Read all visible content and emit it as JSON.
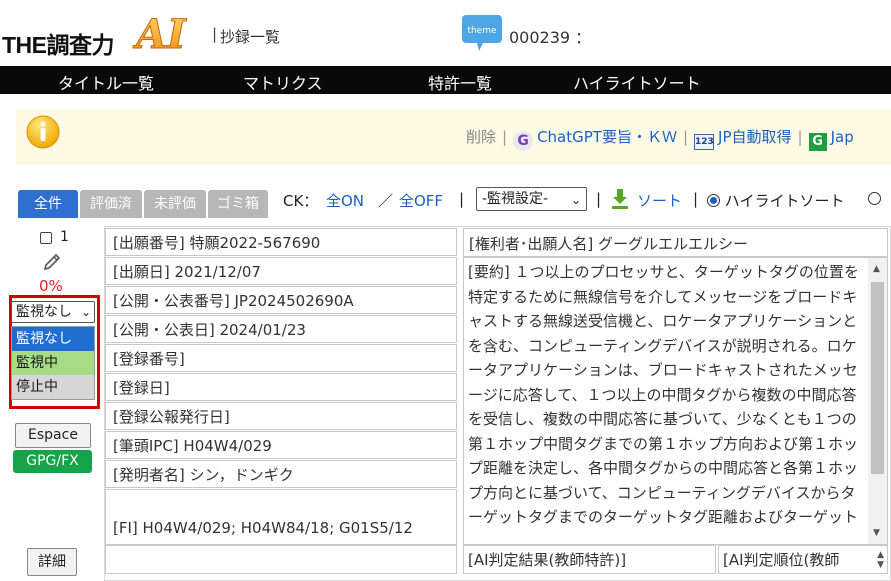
{
  "header": {
    "logo_text": "THE調査力",
    "logo_ai": "AI",
    "separator": "|",
    "page_title": "抄録一覧",
    "theme_icon_label": "theme",
    "theme_code": "000239 ："
  },
  "nav": {
    "items": [
      "タイトル一覧",
      "マトリクス",
      "特許一覧",
      "ハイライトソート"
    ]
  },
  "toolbar": {
    "delete": "削除",
    "chatgpt": "ChatGPT要旨・ＫＷ",
    "jp_auto": "JP自動取得",
    "jap": "Jap",
    "separator": "|"
  },
  "tabs": [
    "全件",
    "評価済",
    "未評価",
    "ゴミ箱"
  ],
  "filters": {
    "ck_label": "CK：",
    "all_on": "全ON",
    "slash": "／",
    "all_off": "全OFF",
    "sep": "|",
    "monitor_select": "-監視設定-",
    "sort": "ソート",
    "highlight_sort": "ハイライトソート"
  },
  "record": {
    "check_number": "1",
    "percent": "0%",
    "monitor_value": "監視なし",
    "monitor_options": [
      "監視なし",
      "監視中",
      "停止中"
    ],
    "espace_button": "Espace",
    "gpg_button": "GPG/FX",
    "detail_button": "詳細",
    "fields": [
      "[出願番号] 特願2022-567690",
      "[出願日] 2021/12/07",
      "[公開・公表番号] JP2024502690A",
      "[公開・公表日] 2024/01/23",
      "[登録番号]",
      "[登録日]",
      "[登録公報発行日]",
      "[筆頭IPC] H04W4/029",
      "[発明者名] シン，ドンギク",
      "[FI] H04W4/029; H04W84/18; G01S5/12"
    ],
    "applicant": "[権利者･出願人名] グーグルエルエルシー",
    "summary": "[要約] １つ以上のプロセッサと、ターゲットタグの位置を特定するために無線信号を介してメッセージをブロードキャストする無線送受信機と、ロケータアプリケーションとを含む、コンピューティングデバイスが説明される。ロケータアプリケーションは、ブロードキャストされたメッセージに応答して、１つ以上の中間タグから複数の中間応答を受信し、複数の中間応答に基づいて、少なくとも１つの第１ホップ中間タグまでの第１ホップ方向および第１ホップ距離を決定し、各中間タグからの中間応答と各第１ホップ方向とに基づいて、コンピューティングデバイスからターゲットタグまでのターゲットタグ距離およびターゲット",
    "ai_result": "[AI判定結果(教師特許)]",
    "ai_rank": "[AI判定順位(教師"
  },
  "colors": {
    "nav_bg": "#0a0a0a",
    "tab_active": "#2f6fcf",
    "tab_inactive": "#b7b7b7",
    "link": "#1a5fc7",
    "percent_red": "#e02020",
    "frame_red": "#d00000",
    "option_selected": "#1e6fd0",
    "option_watching": "#a6dc86",
    "option_stopped": "#d6d6d6",
    "gpg_green": "#16a34a",
    "toolbar_bg": "#fefbe4"
  }
}
